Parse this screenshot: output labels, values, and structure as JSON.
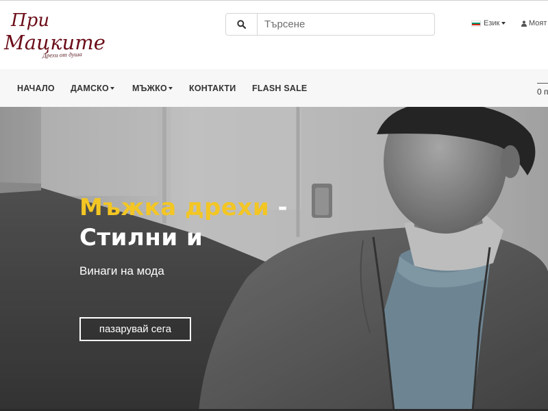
{
  "header": {
    "logo": {
      "line1": "При",
      "line2": "Мацките",
      "tagline": "Дрехи от душа"
    },
    "search": {
      "placeholder": "Търсене",
      "value": ""
    },
    "language": {
      "label": "Език",
      "flag_colors": [
        "#ffffff",
        "#00966e",
        "#d62612"
      ]
    },
    "account": {
      "label": "Моят"
    }
  },
  "nav": {
    "items": [
      {
        "label": "НАЧАЛО",
        "dropdown": false
      },
      {
        "label": "ДАМСКО",
        "dropdown": true
      },
      {
        "label": "МЪЖКО",
        "dropdown": true
      },
      {
        "label": "КОНТАКТИ",
        "dropdown": false
      },
      {
        "label": "FLASH SALE",
        "dropdown": false
      }
    ],
    "cart_text": "0 п"
  },
  "hero": {
    "title_accent": "Мъжка дрехи",
    "title_dash": " -",
    "title_line2": "Стилни и",
    "subtitle": "Винаги на мода",
    "button_label": "пазарувай сега"
  },
  "colors": {
    "accent_yellow": "#f3c623",
    "brand_maroon": "#6b0d18",
    "nav_background": "#f7f7f7"
  },
  "icons": [
    "search-icon",
    "flag-icon",
    "user-icon",
    "caret-down-icon"
  ]
}
